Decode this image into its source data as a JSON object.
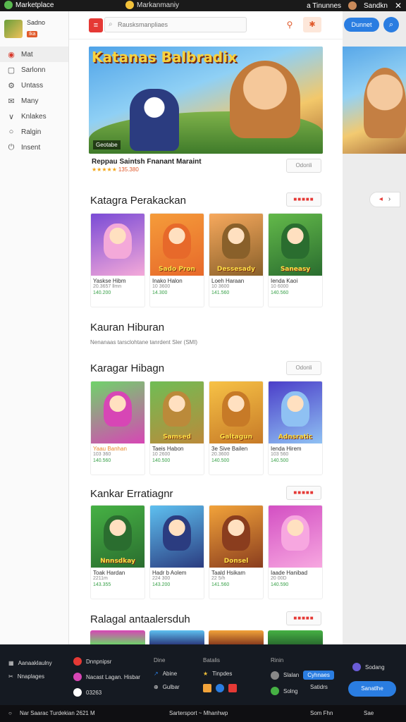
{
  "window": {
    "title": "Marketplace",
    "center_title": "Markanmaniy",
    "right_user": "a Tinunnes",
    "right_label": "Sandkn"
  },
  "sidebar": {
    "profile": {
      "name": "Sadno",
      "badge": "Ika"
    },
    "items": [
      {
        "label": "Mat",
        "icon": "home-icon"
      },
      {
        "label": "Sarlonn",
        "icon": "square-icon"
      },
      {
        "label": "Untass",
        "icon": "gear-icon"
      },
      {
        "label": "Many",
        "icon": "mail-icon"
      },
      {
        "label": "Knlakes",
        "icon": "chevron-icon"
      },
      {
        "label": "Ralgin",
        "icon": "circle-icon"
      },
      {
        "label": "Insent",
        "icon": "power-icon"
      }
    ]
  },
  "header": {
    "search_placeholder": "Rausksmanpliaes",
    "primary_button": "Dunnet"
  },
  "featured": {
    "title": "Katanas Balbradix",
    "tag": "Geotabe",
    "caption": "Reppau Saintsh Fnanant Maraint",
    "rating": "★★★★★",
    "rating_count": "135.380",
    "button": "Odonli"
  },
  "sections": [
    {
      "title": "Katagra Perakackan",
      "button": "■■■■■",
      "items": [
        {
          "name": "Yaskse Hibm",
          "sub": "20.3657 llmn",
          "price": "140.200",
          "label": "",
          "colors": [
            "#7a4bd6",
            "#f4a9d9"
          ]
        },
        {
          "name": "Inako Halon",
          "sub": "10 3600",
          "price": "14.300",
          "label": "Sado Pron",
          "colors": [
            "#f59c3a",
            "#e7692a"
          ]
        },
        {
          "name": "Loeh Haraan",
          "sub": "10 3600",
          "price": "141.560",
          "label": "Dessesady",
          "colors": [
            "#f7a95d",
            "#89602a"
          ]
        },
        {
          "name": "Ienda Kaoi",
          "sub": "10 6000",
          "price": "140.560",
          "label": "Saneasy",
          "colors": [
            "#63b94a",
            "#2a6d2f"
          ]
        }
      ]
    },
    {
      "title": "Kauran Hiburan",
      "subtitle": "Nenanaas tarsclohtane tanrdent Sler (SMI)",
      "items": []
    },
    {
      "title": "Karagar Hibagn",
      "button": "Odonli",
      "items": [
        {
          "name": "Yaau Banhan",
          "sub": "103 360",
          "price": "140.560",
          "label": "",
          "colors": [
            "#6fd36a",
            "#d746b5"
          ],
          "orange": true
        },
        {
          "name": "Taeis Habon",
          "sub": "10 2600",
          "price": "140.500",
          "label": "Samsed",
          "colors": [
            "#6fbd55",
            "#bb8a3a"
          ]
        },
        {
          "name": "3e Sive Bailen",
          "sub": "20.3600",
          "price": "140.500",
          "label": "Galtagun",
          "colors": [
            "#f7c246",
            "#c77a27"
          ]
        },
        {
          "name": "Ienda Hirem",
          "sub": "103 560",
          "price": "140.500",
          "label": "Adnsratic",
          "colors": [
            "#4b3ec9",
            "#8fc1f3"
          ]
        }
      ]
    },
    {
      "title": "Kankar Erratiagnr",
      "button": "■■■■■",
      "items": [
        {
          "name": "Toak Hardan",
          "sub": "2211m",
          "price": "143.355",
          "label": "Nnnsdkay",
          "colors": [
            "#46b144",
            "#2a6d2f"
          ]
        },
        {
          "name": "Hadr b Aolem",
          "sub": "224 300",
          "price": "143.200",
          "label": "",
          "colors": [
            "#5ec0f0",
            "#2b3c80"
          ]
        },
        {
          "name": "Taald Hsikam",
          "sub": "22 5/h",
          "price": "141.560",
          "label": "Donsel",
          "colors": [
            "#f2a33a",
            "#8a3d1e"
          ]
        },
        {
          "name": "Iaade Hanibad",
          "sub": "20 00D",
          "price": "140.590",
          "label": "",
          "colors": [
            "#d34fc3",
            "#f7a7e0"
          ]
        }
      ]
    },
    {
      "title": "Ralagal antaalersduh",
      "items": []
    }
  ],
  "footer": {
    "left": [
      {
        "label": "Aanaaklaulny"
      },
      {
        "label": "Nnaplages"
      }
    ],
    "col2": [
      "Dnnpnipsr",
      "Nacast Lagan. Hisbar",
      "03263"
    ],
    "col3_head": "Dine",
    "col3": [
      "Abine",
      "Gulbar"
    ],
    "col4_head": "Batalis",
    "col4": [
      "Tinpdes"
    ],
    "col5_head": "Rinin",
    "col5": [
      "Slalan",
      "Solng"
    ],
    "col5_pill": "Cyhnaes",
    "col6": [
      "Sodang",
      "Satidrs"
    ],
    "cta": "Sanatlhe"
  },
  "bottombar": {
    "left": "Nar Saarac Turdekian 2621 M",
    "center": "Sartersport ~ Mhanhwp",
    "right1": "Som Fhn",
    "right2": "Sae"
  }
}
